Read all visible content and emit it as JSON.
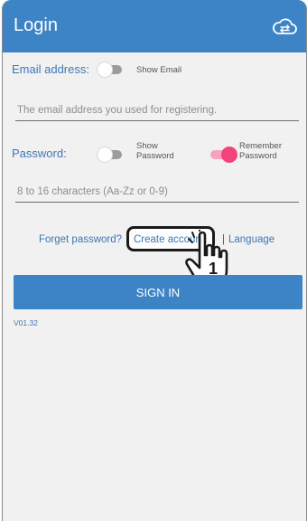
{
  "appbar": {
    "title": "Login",
    "cloud_icon": "cloud-sync-icon"
  },
  "email": {
    "label": "Email address:",
    "toggle_label": "Show Email",
    "toggle_on": false,
    "placeholder": "The email address you used for registering.",
    "value": ""
  },
  "password": {
    "label": "Password:",
    "show_label_line1": "Show",
    "show_label_line2": "Password",
    "show_on": false,
    "remember_label_line1": "Remember",
    "remember_label_line2": "Password",
    "remember_on": true,
    "placeholder": "8 to 16 characters (Aa-Zz or 0-9)",
    "value": ""
  },
  "links": {
    "forget": "Forget password?",
    "create": "Create account",
    "separator": "|",
    "language": "Language"
  },
  "signin_label": "SIGN IN",
  "version": "V01.32",
  "callout": {
    "number": "1",
    "icon": "pointing-hand-icon"
  },
  "colors": {
    "primary": "#3d84c6",
    "accent": "#f0447b",
    "background": "#f1f1f1"
  }
}
